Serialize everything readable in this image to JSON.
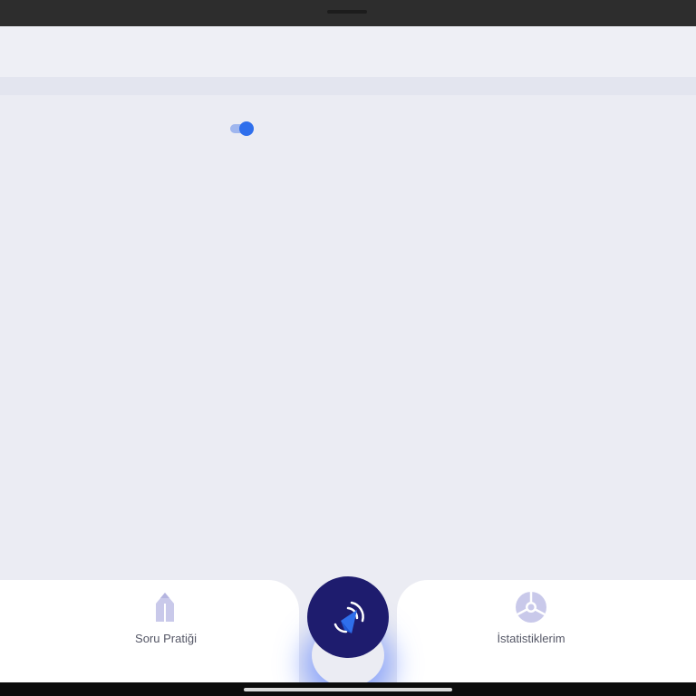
{
  "colors": {
    "accent": "#2f6fec",
    "fab_background": "#1e1c6e",
    "tab_icon": "#c9c9ea",
    "page_background": "#ebecf3"
  },
  "settings": {
    "toggle_state": "on"
  },
  "bottom_nav": {
    "left_tab": {
      "label": "Soru Pratiği",
      "icon": "pencil-icon"
    },
    "center_button": {
      "icon": "rocket-icon"
    },
    "right_tab": {
      "label": "İstatistiklerim",
      "icon": "pie-chart-icon"
    }
  }
}
